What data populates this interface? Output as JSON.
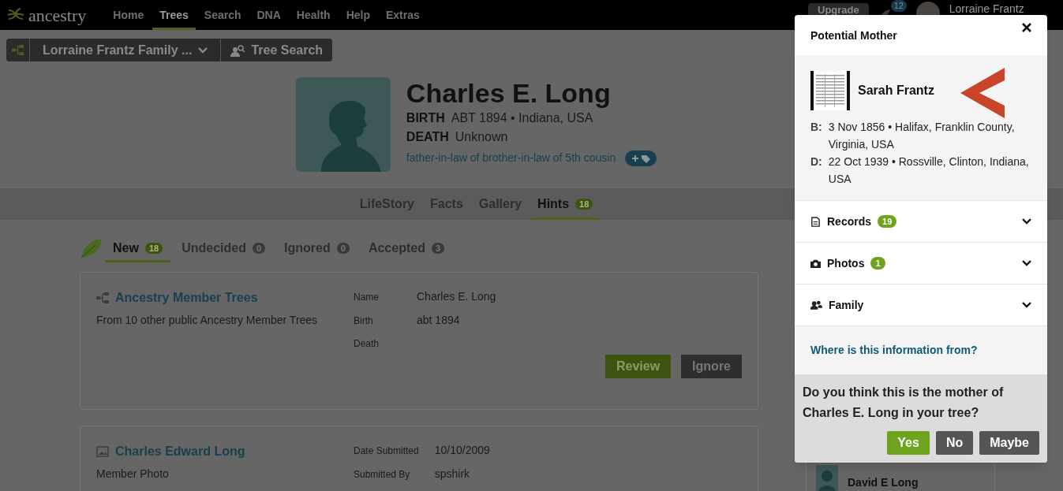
{
  "nav": {
    "logo": "ancestry",
    "items": [
      {
        "label": "Home",
        "selected": false
      },
      {
        "label": "Trees",
        "selected": true
      },
      {
        "label": "Search",
        "selected": false
      },
      {
        "label": "DNA",
        "selected": false
      },
      {
        "label": "Health",
        "selected": false
      },
      {
        "label": "Help",
        "selected": false
      },
      {
        "label": "Extras",
        "selected": false
      }
    ],
    "upgrade": "Upgrade",
    "notifications": "12",
    "user": "Lorraine Frantz"
  },
  "toolbar": {
    "tree_name": "Lorraine Frantz Family ...",
    "tree_search": "Tree Search"
  },
  "person": {
    "name": "Charles E. Long",
    "birth_label": "BIRTH",
    "birth": "ABT 1894 • Indiana, USA",
    "death_label": "DEATH",
    "death": "Unknown",
    "relationship": "father-in-law of brother-in-law of 5th cousin"
  },
  "person_tabs": [
    {
      "label": "LifeStory",
      "selected": false
    },
    {
      "label": "Facts",
      "selected": false
    },
    {
      "label": "Gallery",
      "selected": false
    },
    {
      "label": "Hints",
      "count": "18",
      "selected": true
    }
  ],
  "hint_tabs": [
    {
      "label": "New",
      "count": "18",
      "selected": true
    },
    {
      "label": "Undecided",
      "count": "0",
      "selected": false
    },
    {
      "label": "Ignored",
      "count": "0",
      "selected": false
    },
    {
      "label": "Accepted",
      "count": "3",
      "selected": false
    }
  ],
  "hints": [
    {
      "kind": "tree",
      "title": "Ancestry Member Trees",
      "subtitle": "From 10 other public Ancestry Member Trees",
      "fields": [
        {
          "label": "Name",
          "value": "Charles E. Long"
        },
        {
          "label": "Birth",
          "value": "abt 1894"
        },
        {
          "label": "Death"
        }
      ],
      "buttons": [
        "Review",
        "Ignore"
      ]
    },
    {
      "kind": "photo",
      "title": "Charles Edward Long",
      "subtitle": "Member Photo",
      "fields": [
        {
          "label": "Date Submitted",
          "value": "10/10/2009"
        },
        {
          "label": "Submitted By",
          "value": "spshirk"
        }
      ]
    }
  ],
  "side_card": {
    "name": "David E Long"
  },
  "modal": {
    "title": "Potential Mother",
    "name": "Sarah Frantz",
    "birth_label": "B:",
    "birth": "3 Nov 1856 • Halifax, Franklin County, Virginia, USA",
    "death_label": "D:",
    "death": "22 Oct 1939 • Rossville, Clinton, Indiana, USA",
    "sections": [
      {
        "kind": "records",
        "label": "Records",
        "count": "19",
        "expanded": false
      },
      {
        "kind": "photos",
        "label": "Photos",
        "count": "1",
        "expanded": false
      },
      {
        "kind": "family",
        "label": "Family",
        "expanded": false
      }
    ],
    "source_link": "Where is this information from?",
    "question": "Do you think this is the mother of Charles E. Long in your tree?",
    "answers": [
      {
        "kind": "primary",
        "label": "Yes"
      },
      {
        "kind": "secondary",
        "label": "No"
      },
      {
        "kind": "secondary",
        "label": "Maybe"
      }
    ]
  }
}
